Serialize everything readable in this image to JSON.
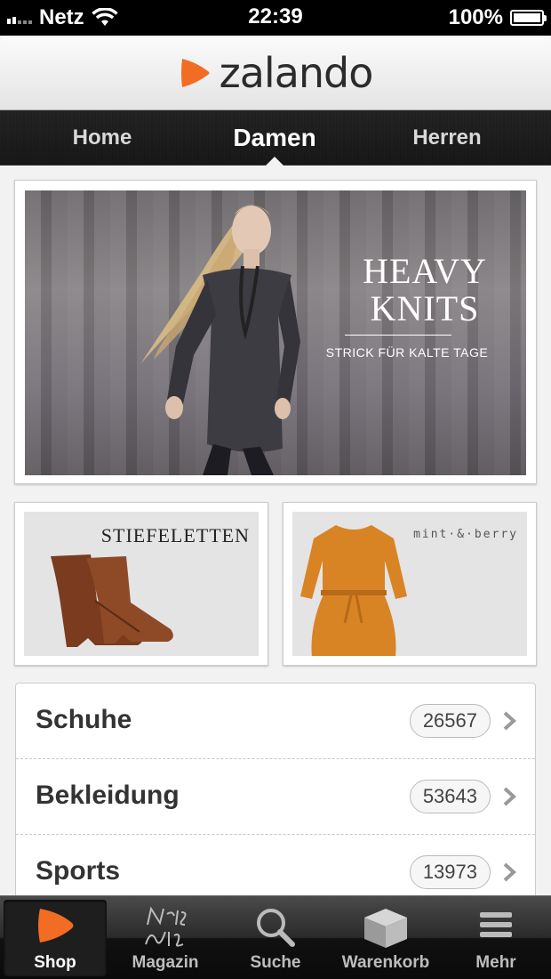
{
  "status_bar": {
    "carrier": "Netz",
    "time": "22:39",
    "battery_percent": "100%",
    "battery_level": 1.0
  },
  "header": {
    "brand": "zalando",
    "brand_color": "#f26c23"
  },
  "tabs": [
    {
      "label": "Home"
    },
    {
      "label": "Damen",
      "active": true
    },
    {
      "label": "Herren"
    }
  ],
  "hero": {
    "title_line1": "HEAVY",
    "title_line2": "KNITS",
    "subtitle": "STRICK FÜR KALTE TAGE"
  },
  "tiles": {
    "left_label": "STIEFELETTEN",
    "right_label": "mint·&·berry"
  },
  "categories": [
    {
      "name": "Schuhe",
      "count": "26567"
    },
    {
      "name": "Bekleidung",
      "count": "53643"
    },
    {
      "name": "Sports",
      "count": "13973"
    }
  ],
  "tab_bar": {
    "items": [
      {
        "label": "Shop",
        "icon": "zalando-play-icon",
        "active": true
      },
      {
        "label": "Magazin",
        "icon": "news-style-icon"
      },
      {
        "label": "Suche",
        "icon": "search-icon"
      },
      {
        "label": "Warenkorb",
        "icon": "cart-box-icon"
      },
      {
        "label": "Mehr",
        "icon": "menu-icon"
      }
    ]
  }
}
